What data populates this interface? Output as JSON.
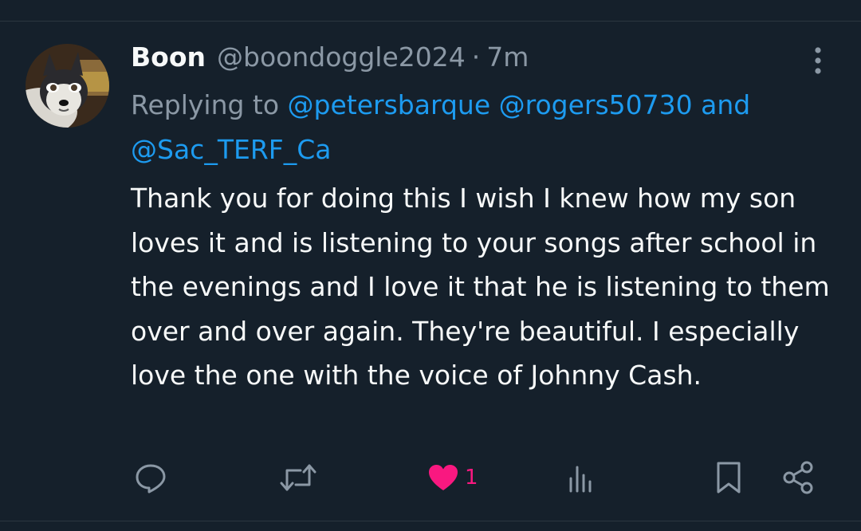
{
  "tweet": {
    "display_name": "Boon",
    "handle": "@boondoggle2024",
    "separator": "·",
    "time": "7m",
    "replying_prefix": "Replying to",
    "mentions": [
      "@petersbarque",
      "@rogers50730",
      "@Sac_TERF_Ca"
    ],
    "mention_joiner": "and",
    "text": "Thank you for doing this I wish I knew how my son loves it and is listening to your songs after school in the evenings and I love it that he is listening to them over and over again. They're beautiful. I especially love the one with the voice of Johnny Cash."
  },
  "actions": {
    "reply_icon": "reply-icon",
    "retweet_icon": "retweet-icon",
    "like_icon": "heart-filled-icon",
    "like_count": "1",
    "views_icon": "views-icon",
    "bookmark_icon": "bookmark-icon",
    "share_icon": "share-icon",
    "liked": true
  },
  "colors": {
    "background": "#15202b",
    "text": "#f7f9f9",
    "muted": "#8b98a5",
    "accent": "#1d9bf0",
    "like": "#f91880"
  }
}
